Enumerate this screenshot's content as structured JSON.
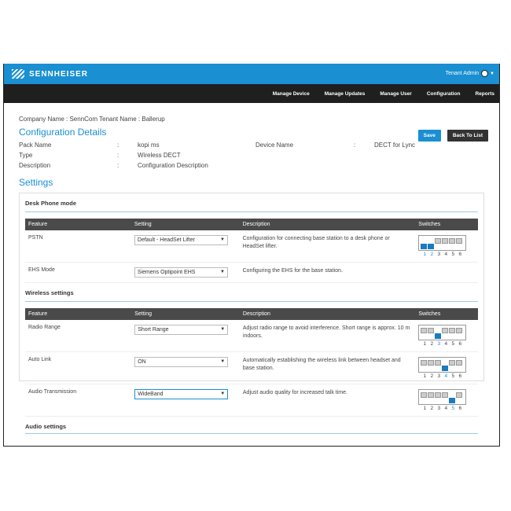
{
  "header": {
    "brand": "SENNHEISER",
    "user": "Tenant Admin"
  },
  "nav": [
    "Manage Device",
    "Manage Updates",
    "Manage User",
    "Configuration",
    "Reports"
  ],
  "company_line": "Company Name : SennCom  Tenant Name : Ballerup",
  "page_title": "Configuration Details",
  "buttons": {
    "save": "Save",
    "back": "Back To List"
  },
  "meta": {
    "pack_name_label": "Pack Name",
    "pack_name_value": "kopi ms",
    "device_name_label": "Device Name",
    "device_name_value": "DECT for Lync",
    "type_label": "Type",
    "type_value": "Wireless DECT",
    "description_label": "Description",
    "description_value": "Configuration Description",
    "sep": ":"
  },
  "settings_title": "Settings",
  "columns": {
    "feature": "Feature",
    "setting": "Setting",
    "description": "Description",
    "switches": "Switches"
  },
  "switch_numbers": [
    "1",
    "2",
    "3",
    "4",
    "5",
    "6"
  ],
  "sections": [
    {
      "title": "Desk Phone mode",
      "rows": [
        {
          "feature": "PSTN",
          "setting": "Default - HeadSet Lifter",
          "description": "Configuration for connecting base station to a desk phone or HeadSet lifter.",
          "switches": [
            1,
            1,
            0,
            0,
            0,
            0
          ]
        },
        {
          "feature": "EHS Mode",
          "setting": "Siemens Optipoint EHS",
          "description": "Configuring the EHS for the base station."
        }
      ]
    },
    {
      "title": "Wireless settings",
      "rows": [
        {
          "feature": "Radio Range",
          "setting": "Short Range",
          "description": "Adjust radio range to avoid interference. Short range is approx. 10 m indoors.",
          "switches": [
            0,
            0,
            1,
            0,
            0,
            0
          ]
        },
        {
          "feature": "Auto Link",
          "setting": "ON",
          "description": "Automatically establishing the wireless link between headset and base station.",
          "switches": [
            0,
            0,
            0,
            1,
            0,
            0
          ]
        },
        {
          "feature": "Audio Transmission",
          "setting": "WideBand",
          "description": "Adjust audio quality for increased talk time.",
          "switches": [
            0,
            0,
            0,
            0,
            1,
            0
          ]
        }
      ]
    },
    {
      "title": "Audio settings"
    }
  ],
  "colors": {
    "brand_blue": "#1a8fd1",
    "nav_dark": "#1f1f1f",
    "switch_on": "#1a7cc0"
  }
}
